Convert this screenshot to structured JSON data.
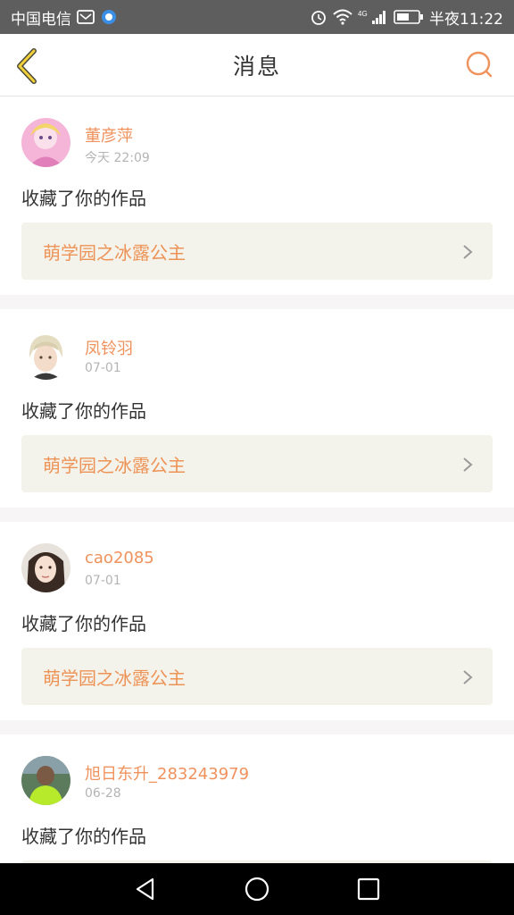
{
  "status_bar": {
    "carrier": "中国电信",
    "network": "4G",
    "time": "半夜11:22",
    "icons": [
      "message-icon",
      "app-icon",
      "alarm-icon",
      "wifi-icon",
      "signal-icon",
      "battery-icon"
    ]
  },
  "header": {
    "title": "消息",
    "back_icon": "chevron-left-icon",
    "search_icon": "search-icon",
    "accent_color": "#f0925c"
  },
  "messages": [
    {
      "username": "董彦萍",
      "time": "今天 22:09",
      "action": "收藏了你的作品",
      "work_title": "萌学园之冰露公主"
    },
    {
      "username": "凤铃羽",
      "time": "07-01",
      "action": "收藏了你的作品",
      "work_title": "萌学园之冰露公主"
    },
    {
      "username": "cao2085",
      "time": "07-01",
      "action": "收藏了你的作品",
      "work_title": "萌学园之冰露公主"
    },
    {
      "username": "旭日东升_283243979",
      "time": "06-28",
      "action": "收藏了你的作品",
      "work_title": ""
    }
  ],
  "nav_bar": {
    "icons": [
      "back-triangle-icon",
      "home-circle-icon",
      "recents-square-icon"
    ]
  }
}
